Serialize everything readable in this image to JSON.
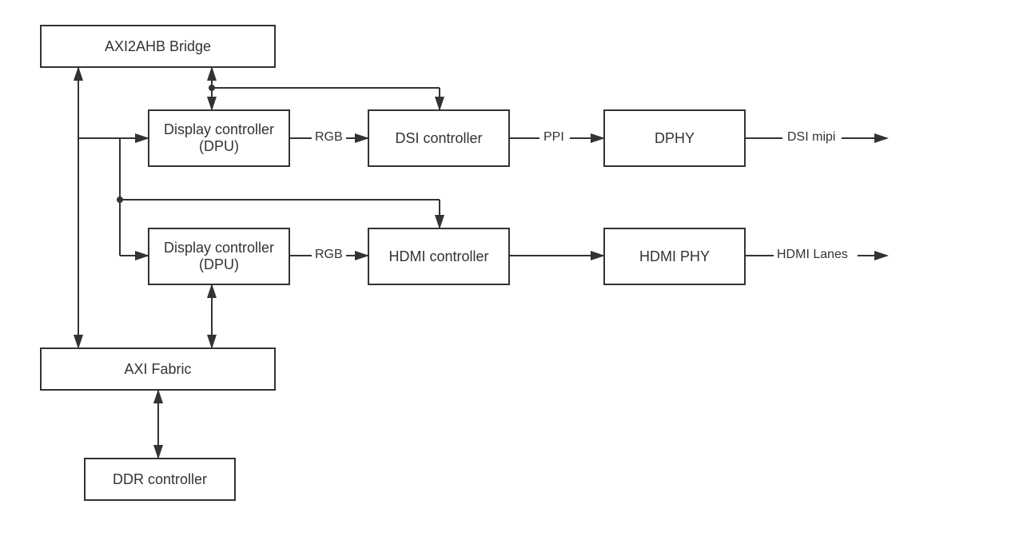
{
  "blocks": {
    "axi2ahb": "AXI2AHB Bridge",
    "dpu1": "Display controller (DPU)",
    "dpu2": "Display controller (DPU)",
    "dsi": "DSI controller",
    "hdmi_ctrl": "HDMI controller",
    "dphy": "DPHY",
    "hdmi_phy": "HDMI PHY",
    "axi_fabric": "AXI Fabric",
    "ddr": "DDR controller"
  },
  "labels": {
    "rgb1": "RGB",
    "rgb2": "RGB",
    "ppi": "PPI",
    "dsi_mipi": "DSI mipi",
    "hdmi_lanes": "HDMI Lanes"
  }
}
